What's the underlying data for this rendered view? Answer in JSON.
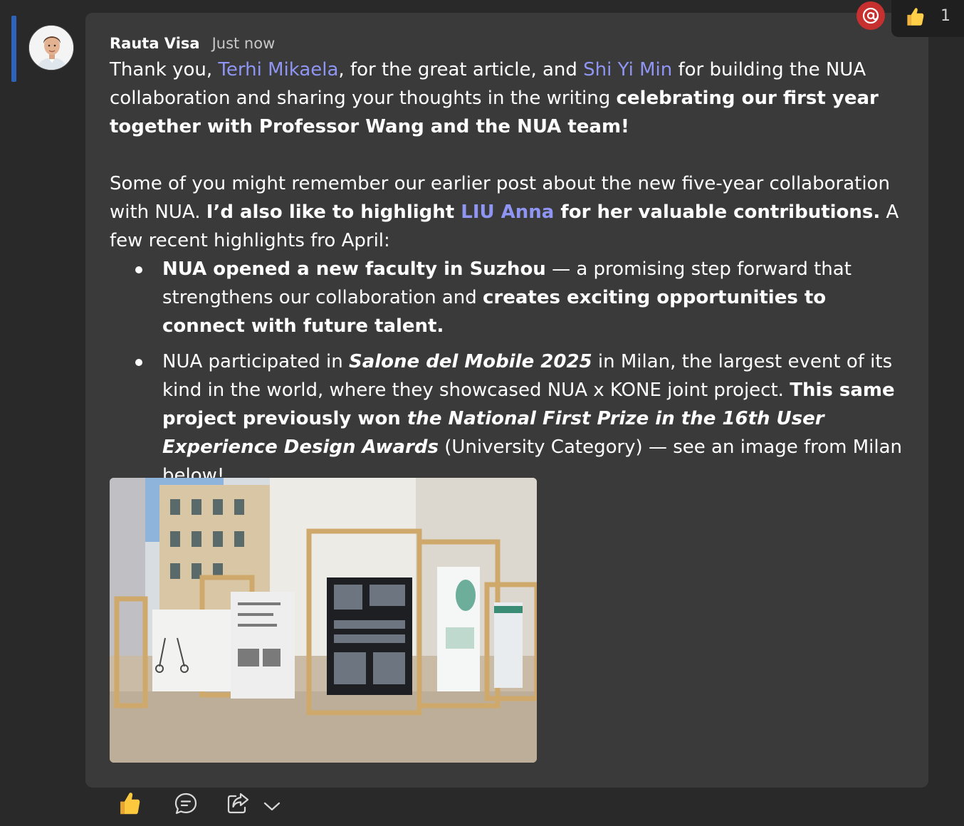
{
  "post": {
    "author": "Rauta Visa",
    "time": "Just now"
  },
  "message": {
    "p1": {
      "t1": "Thank you, ",
      "mention1": "Terhi Mikaela",
      "t2": ", for the great article, and ",
      "mention2": "Shi Yi Min",
      "t3": " for building the NUA collaboration and sharing your thoughts in the writing ",
      "b1": "celebrating our first year together with Professor Wang and the NUA team!"
    },
    "p2": {
      "t1": "Some of you might remember our earlier post about the new five-year collaboration with NUA. ",
      "b1": "I’d also like to highlight ",
      "mention1": "LIU Anna",
      "b2": " for her valuable contributions.",
      "t2": " A few recent highlights fro April:"
    },
    "bullets": [
      {
        "b1": "NUA opened a new faculty in Suzhou",
        "t1": " — a promising step forward that strengthens our collaboration and ",
        "b2": "creates exciting opportunities to connect with future talent."
      },
      {
        "t1": "NUA participated in ",
        "bi1": "Salone del Mobile 2025",
        "t2": " in Milan, the largest event of its kind in the world, where they showcased NUA x KONE joint project. ",
        "b1": "This same project previously won ",
        "bi2": "the National First Prize in the 16th User Experience Design Awards",
        "t3": " (University Category) — see an image from Milan below!"
      }
    ]
  },
  "reactions": {
    "like_count": "1"
  },
  "icons": {
    "mention": "at-icon",
    "like": "thumbs-up-icon",
    "reply": "reply-icon",
    "share": "share-icon",
    "more": "chevron-down-icon"
  },
  "colors": {
    "background": "#292929",
    "card": "#3a3a3a",
    "mention": "#8f95f2",
    "accent": "#2f63b8",
    "at_badge": "#c6312f"
  }
}
